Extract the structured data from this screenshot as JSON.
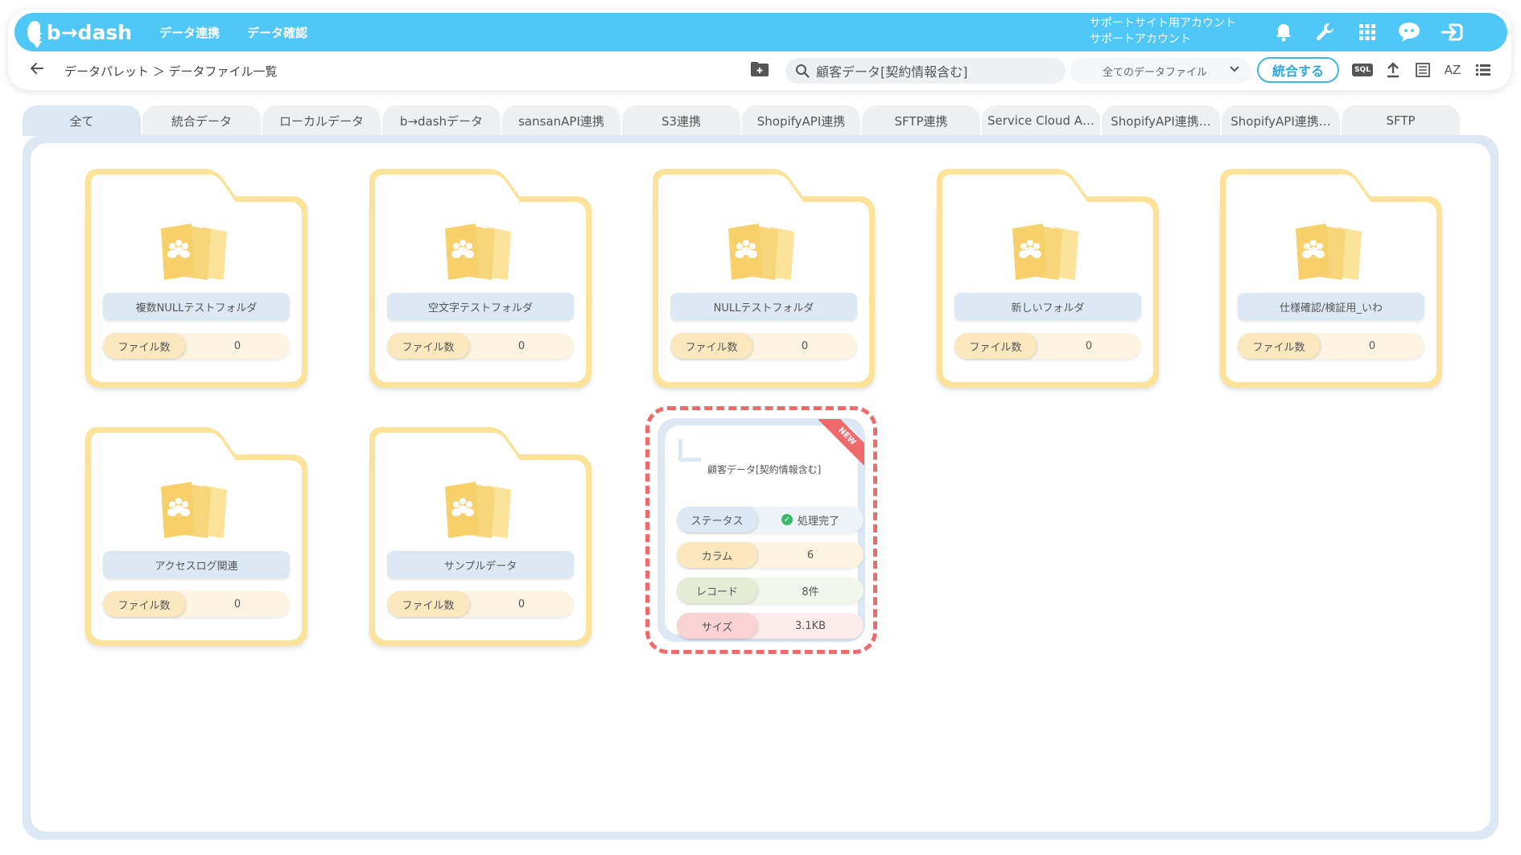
{
  "header": {
    "logo_text": "b→dash",
    "nav": [
      "データ連携",
      "データ確認"
    ],
    "account_line1": "サポートサイト用アカウント",
    "account_line2": "サポートアカウント"
  },
  "toolbar": {
    "breadcrumb": "データパレット ＞ データファイル一覧",
    "search_value": "顧客データ[契約情報含む]",
    "filter_value": "全てのデータファイル",
    "merge_label": "統合する",
    "sql_label": "SQL",
    "sort_label": "AZ"
  },
  "tabs": [
    "全て",
    "統合データ",
    "ローカルデータ",
    "b→dashデータ",
    "sansanAPI連携",
    "S3連携",
    "ShopifyAPI連携",
    "SFTP連携",
    "Service Cloud A…",
    "ShopifyAPI連携…",
    "ShopifyAPI連携…",
    "SFTP"
  ],
  "folders": [
    {
      "name": "複数NULLテストフォルダ",
      "count_label": "ファイル数",
      "count": "0"
    },
    {
      "name": "空文字テストフォルダ",
      "count_label": "ファイル数",
      "count": "0"
    },
    {
      "name": "NULLテストフォルダ",
      "count_label": "ファイル数",
      "count": "0"
    },
    {
      "name": "新しいフォルダ",
      "count_label": "ファイル数",
      "count": "0"
    },
    {
      "name": "仕様確認/検証用_いわ",
      "count_label": "ファイル数",
      "count": "0"
    },
    {
      "name": "アクセスログ関連",
      "count_label": "ファイル数",
      "count": "0"
    },
    {
      "name": "サンプルデータ",
      "count_label": "ファイル数",
      "count": "0"
    }
  ],
  "file_card": {
    "badge": "NEW",
    "title": "顧客データ[契約情報含む]",
    "rows": [
      {
        "label": "ステータス",
        "value": "処理完了"
      },
      {
        "label": "カラム",
        "value": "6"
      },
      {
        "label": "レコード",
        "value": "8件"
      },
      {
        "label": "サイズ",
        "value": "3.1KB"
      }
    ]
  },
  "colors": {
    "header_blue": "#4fc8f7",
    "folder_yellow": "#fbe39a",
    "panel_blue": "#dce8f3",
    "new_red": "#ef6b6b",
    "status_green": "#3bb86b"
  }
}
